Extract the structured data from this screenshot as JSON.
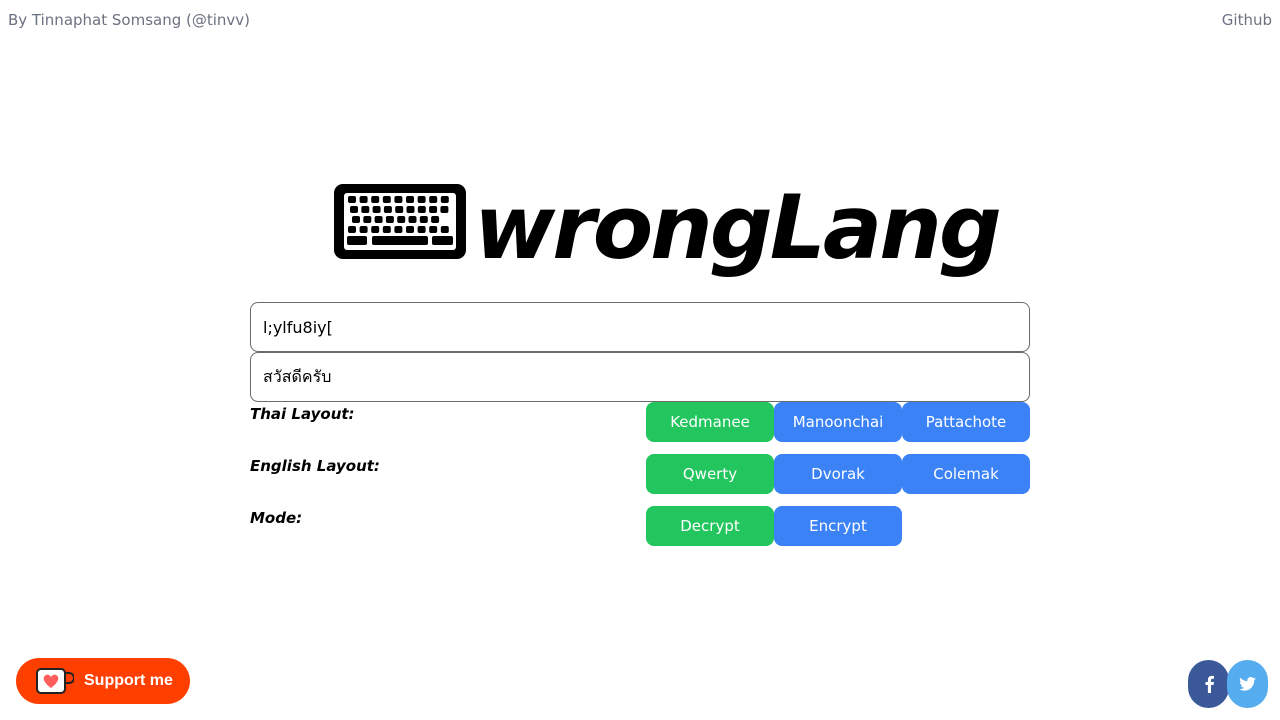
{
  "header": {
    "credit": "By Tinnaphat Somsang (@tinvv)",
    "github_label": "Github"
  },
  "logo": {
    "text": "wrongLang",
    "icon": "keyboard-icon"
  },
  "input": {
    "value": "l;ylfu8iy["
  },
  "output": {
    "value": "สวัสดีครับ"
  },
  "options": {
    "thai_layout": {
      "label": "Thai Layout:",
      "buttons": [
        "Kedmanee",
        "Manoonchai",
        "Pattachote"
      ],
      "selected": "Kedmanee"
    },
    "english_layout": {
      "label": "English Layout:",
      "buttons": [
        "Qwerty",
        "Dvorak",
        "Colemak"
      ],
      "selected": "Qwerty"
    },
    "mode": {
      "label": "Mode:",
      "buttons": [
        "Decrypt",
        "Encrypt"
      ],
      "selected": "Decrypt"
    }
  },
  "footer": {
    "support_label": "Support me",
    "support_icon": "coffee-cup-heart-icon",
    "social": [
      "facebook-icon",
      "twitter-icon"
    ]
  },
  "colors": {
    "selected": "#22c55e",
    "unselected": "#3b82f6",
    "support": "#ff3f00",
    "facebook": "#3b5998",
    "twitter": "#55acee",
    "muted_text": "#6b7280"
  }
}
